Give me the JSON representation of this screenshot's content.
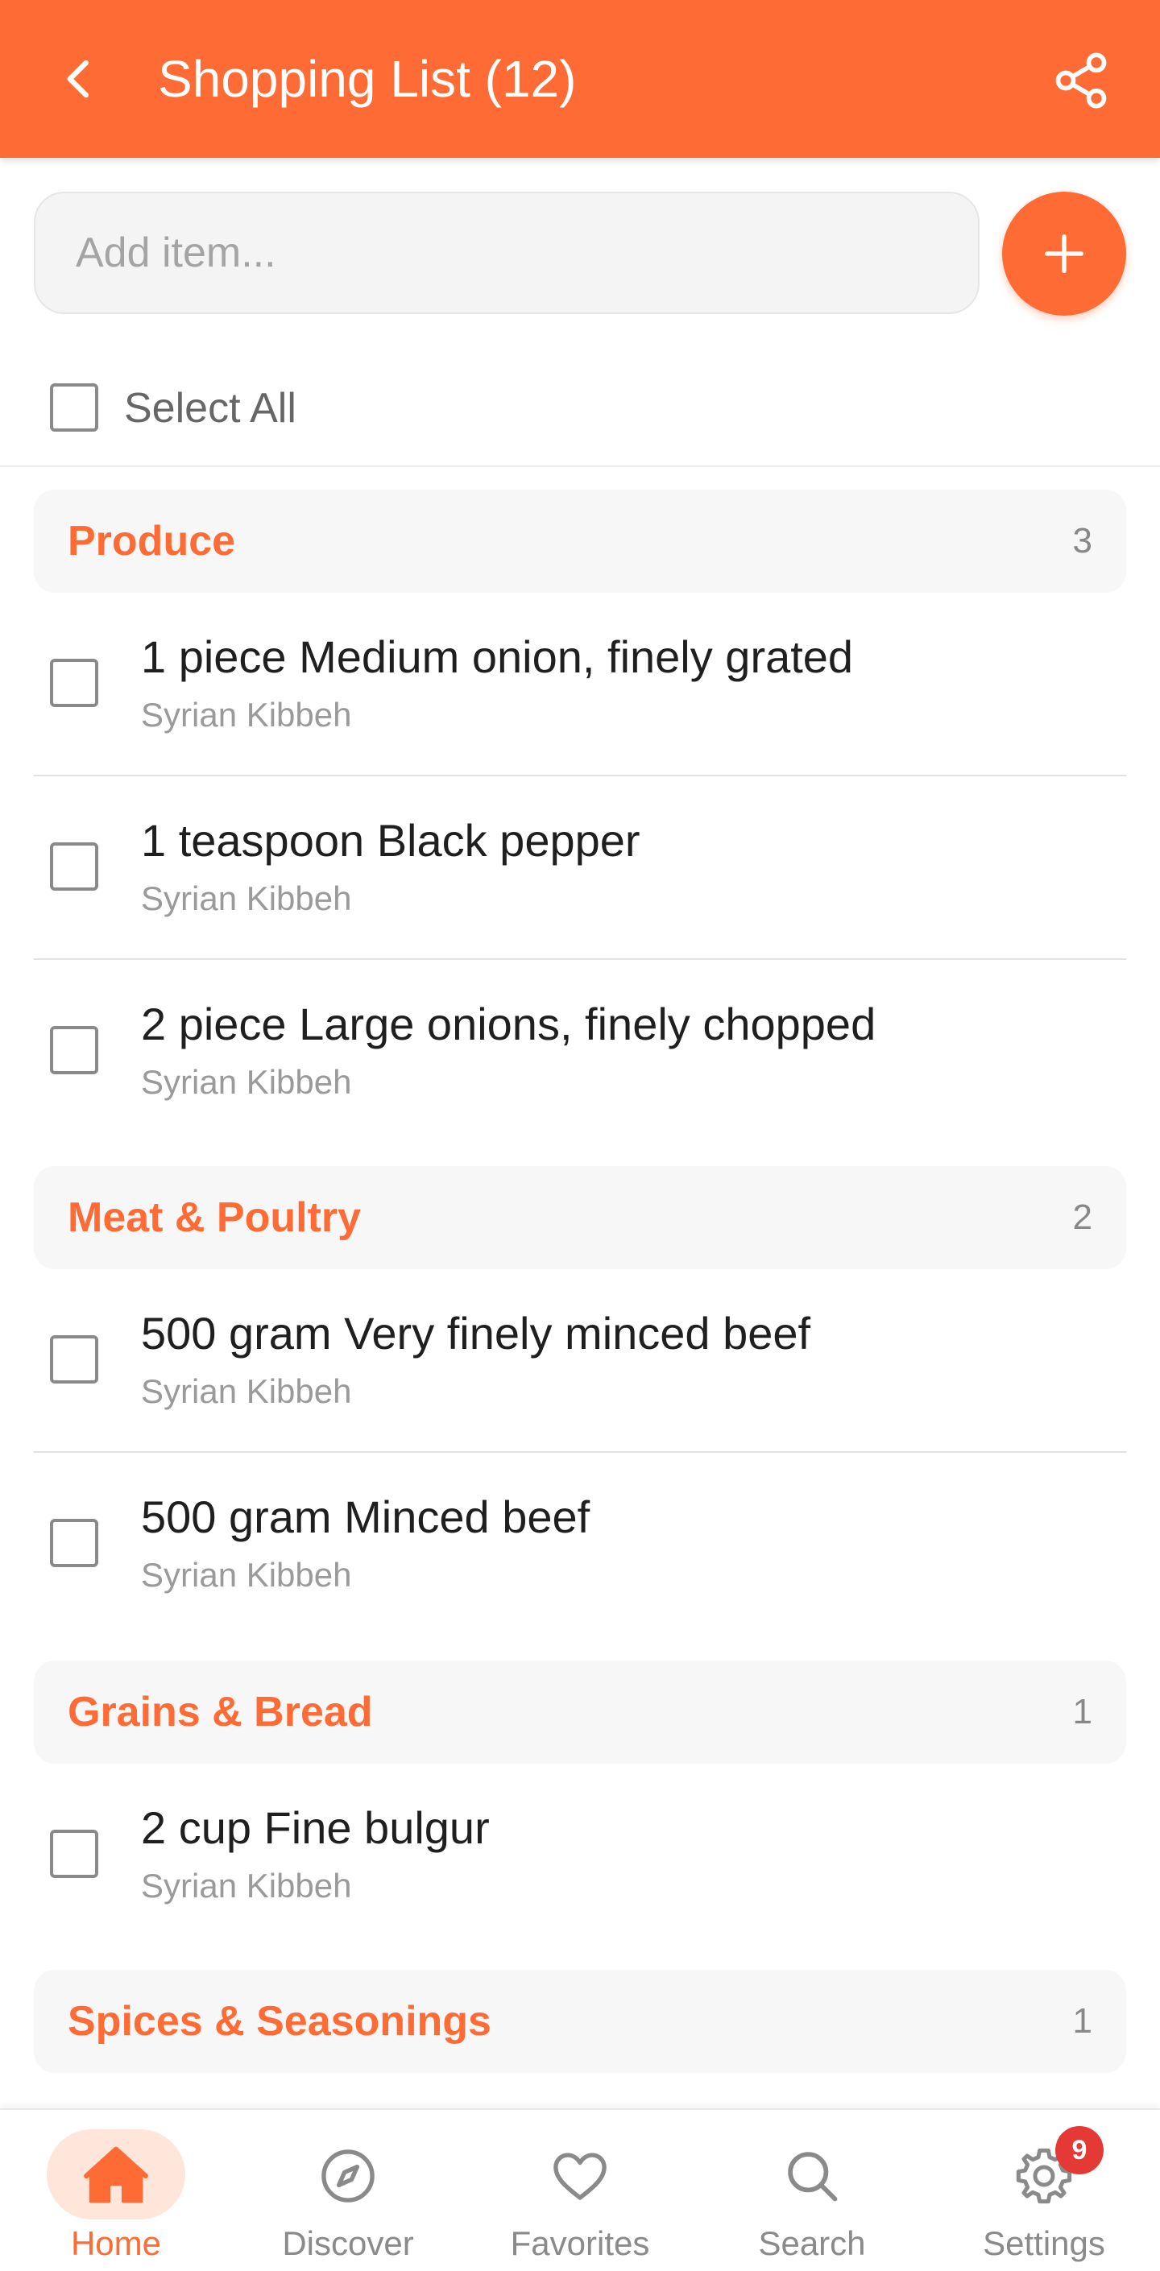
{
  "header": {
    "title": "Shopping List (12)",
    "back_icon": "chevron-left-icon",
    "share_icon": "share-icon",
    "background": "#FF6B35"
  },
  "add_item": {
    "placeholder": "Add item...",
    "value": "",
    "button_icon": "plus-icon"
  },
  "select_all": {
    "label": "Select All",
    "checked": false
  },
  "categories": [
    {
      "name": "Produce",
      "count": "3",
      "items": [
        {
          "name": "1 piece Medium onion, finely grated",
          "source": "Syrian Kibbeh",
          "checked": false
        },
        {
          "name": "1 teaspoon Black pepper",
          "source": "Syrian Kibbeh",
          "checked": false
        },
        {
          "name": "2 piece Large onions, finely chopped",
          "source": "Syrian Kibbeh",
          "checked": false
        }
      ]
    },
    {
      "name": "Meat & Poultry",
      "count": "2",
      "items": [
        {
          "name": "500 gram Very finely minced beef",
          "source": "Syrian Kibbeh",
          "checked": false
        },
        {
          "name": "500 gram Minced beef",
          "source": "Syrian Kibbeh",
          "checked": false
        }
      ]
    },
    {
      "name": "Grains & Bread",
      "count": "1",
      "items": [
        {
          "name": "2 cup Fine bulgur",
          "source": "Syrian Kibbeh",
          "checked": false
        }
      ]
    },
    {
      "name": "Spices & Seasonings",
      "count": "1",
      "items": []
    }
  ],
  "bottom_nav": {
    "items": [
      {
        "label": "Home",
        "icon": "home-icon",
        "active": true
      },
      {
        "label": "Discover",
        "icon": "compass-icon",
        "active": false
      },
      {
        "label": "Favorites",
        "icon": "heart-icon",
        "active": false
      },
      {
        "label": "Search",
        "icon": "search-icon",
        "active": false
      },
      {
        "label": "Settings",
        "icon": "gear-icon",
        "active": false,
        "badge": "9"
      }
    ]
  },
  "colors": {
    "accent": "#FF6B35",
    "accent_light": "#FFE6DA",
    "badge": "#E53935"
  }
}
